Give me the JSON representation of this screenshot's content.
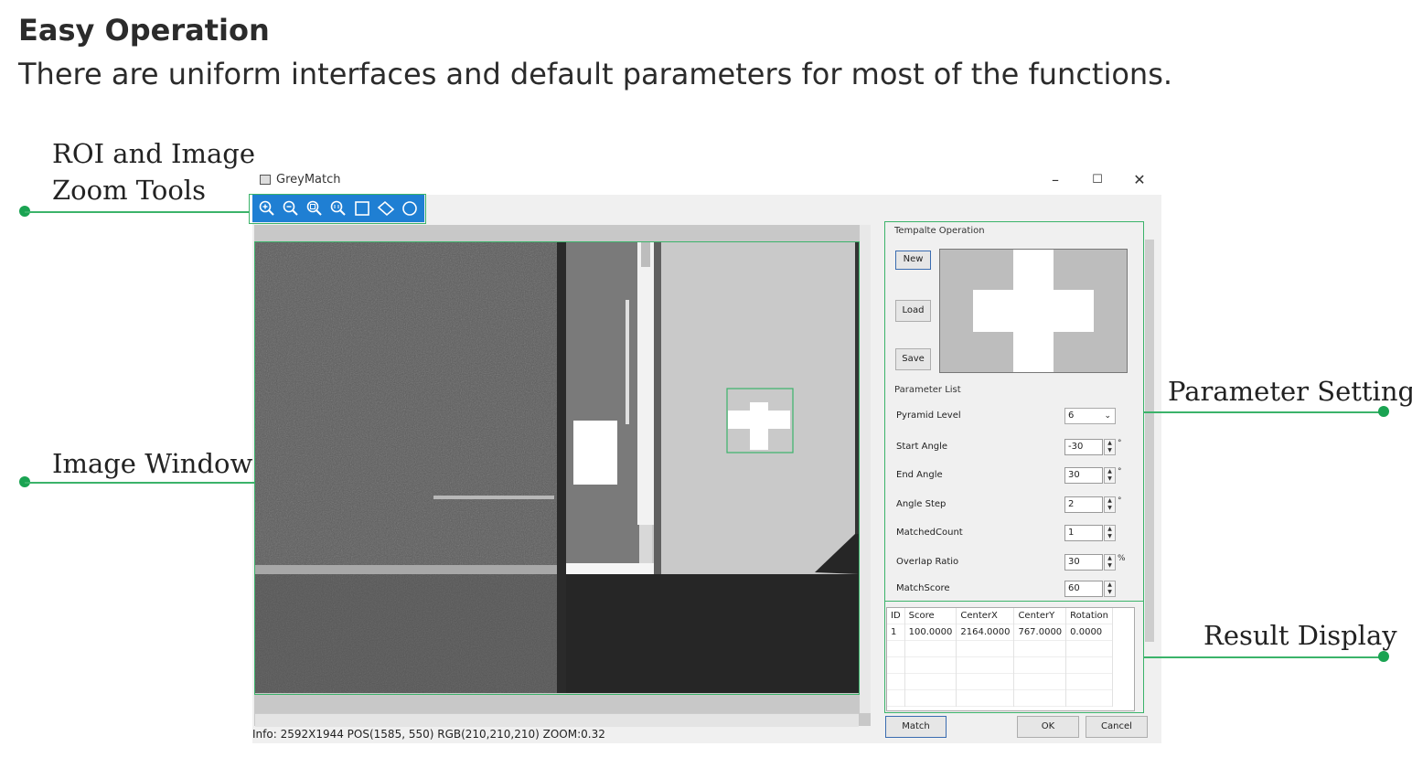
{
  "page": {
    "heading": "Easy Operation",
    "subheading": "There are uniform interfaces and default parameters for most of the functions."
  },
  "callouts": {
    "roi_line1": "ROI and Image",
    "roi_line2": "Zoom Tools",
    "image_window": "Image Window",
    "parameter_setting": "Parameter Setting",
    "result_display": "Result Display"
  },
  "window": {
    "title": "GreyMatch",
    "minimize": "–",
    "maximize": "☐",
    "close": "✕"
  },
  "toolbar": {
    "icons": [
      "zoom-in-icon",
      "zoom-out-icon",
      "zoom-fit-icon",
      "zoom-actual-icon",
      "rect-roi-icon",
      "rotated-rect-roi-icon",
      "circle-roi-icon"
    ]
  },
  "status": {
    "text": "Info: 2592X1944  POS(1585, 550)  RGB(210,210,210)  ZOOM:0.32"
  },
  "template": {
    "group": "Tempalte Operation",
    "new": "New",
    "load": "Load",
    "save": "Save"
  },
  "params": {
    "group": "Parameter List",
    "pyramid_label": "Pyramid Level",
    "pyramid_value": "6",
    "rows": [
      {
        "label": "Start Angle",
        "value": "-30",
        "unit": "°"
      },
      {
        "label": "End Angle",
        "value": "30",
        "unit": "°"
      },
      {
        "label": "Angle Step",
        "value": "2",
        "unit": "°"
      },
      {
        "label": "MatchedCount",
        "value": "1",
        "unit": ""
      },
      {
        "label": "Overlap Ratio",
        "value": "30",
        "unit": "%"
      },
      {
        "label": "MatchScore",
        "value": "60",
        "unit": ""
      }
    ]
  },
  "results": {
    "headers": [
      "ID",
      "Score",
      "CenterX",
      "CenterY",
      "Rotation"
    ],
    "rows": [
      [
        "1",
        "100.0000",
        "2164.0000",
        "767.0000",
        "0.0000"
      ]
    ]
  },
  "buttons": {
    "match": "Match",
    "ok": "OK",
    "cancel": "Cancel"
  },
  "colors": {
    "accent_green": "#3bb36a",
    "toolbar_blue": "#1f7fd3"
  }
}
